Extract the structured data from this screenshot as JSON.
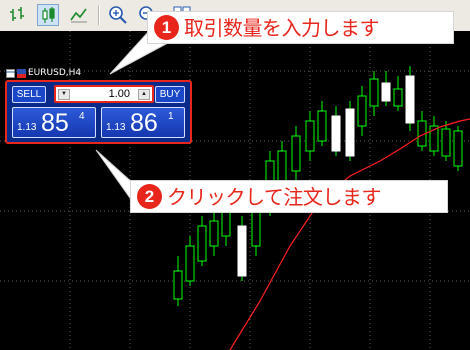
{
  "toolbar": {
    "buttons": [
      {
        "name": "bar-chart-icon",
        "active": false
      },
      {
        "name": "candlestick-chart-icon",
        "active": true
      },
      {
        "name": "line-chart-icon",
        "active": false
      },
      {
        "name": "zoom-in-icon",
        "active": false
      },
      {
        "name": "zoom-out-icon",
        "active": false
      },
      {
        "name": "tile-windows-icon",
        "active": false
      }
    ]
  },
  "chart_window": {
    "symbol": "EURUSD,H4"
  },
  "one_click_trading": {
    "sell_label": "SELL",
    "buy_label": "BUY",
    "lot_value": "1.00",
    "lot_down_symbol": "▼",
    "lot_up_symbol": "▲",
    "sell_price": {
      "prefix": "1.13",
      "big": "85",
      "sup": "4"
    },
    "buy_price": {
      "prefix": "1.13",
      "big": "86",
      "sup": "1"
    }
  },
  "callouts": [
    {
      "number": "1",
      "text": "取引数量を入力します"
    },
    {
      "number": "2",
      "text": "クリックして注文します"
    }
  ],
  "colors": {
    "bull": "#00ff00",
    "bear": "#ffffff",
    "ma_line": "#ff2020",
    "grid": "#5a5a5a",
    "accent": "#e8261c",
    "panel": "#0a2a8a"
  }
}
